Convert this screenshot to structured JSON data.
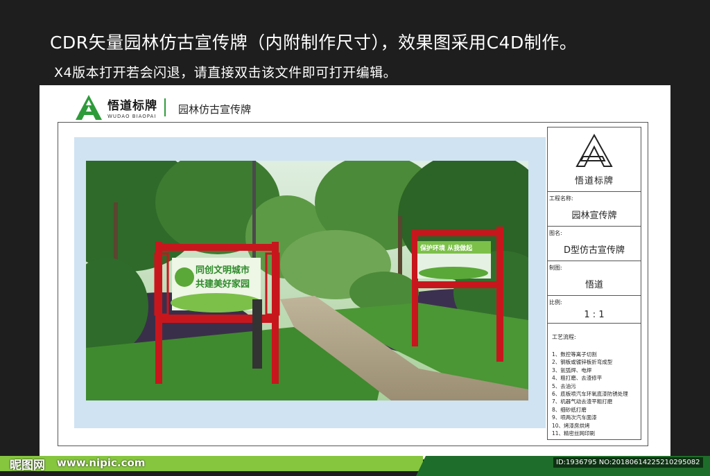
{
  "header": {
    "headline": "CDR矢量园林仿古宣传牌（内附制作尺寸），效果图采用C4D制作。",
    "subline": "X4版本打开若会闪退，请直接双击该文件即可打开编辑。"
  },
  "brand": {
    "name_cn": "悟道标牌",
    "name_en": "WUDAO BIAOPAI",
    "title": "园林仿古宣传牌",
    "accent": "#2e9b3a"
  },
  "signs": {
    "left_text_1": "同创文明城市",
    "left_text_2": "共建美好家园",
    "right_text": "保护环境 从我做起"
  },
  "info": {
    "logo_text": "悟道标牌",
    "project_label": "工程名称:",
    "project_value": "园林宣传牌",
    "drawing_label": "图名:",
    "drawing_value": "D型仿古宣传牌",
    "maker_label": "制图:",
    "maker_value": "悟道",
    "scale_label": "比例:",
    "scale_value": "1 : 1",
    "process_title": "工艺流程:",
    "process_steps": [
      "1、数控等离子切割",
      "2、钢板或镀锌板折弯成型",
      "3、氩弧焊、电焊",
      "4、粗打磨、去渣修平",
      "5、去油污",
      "6、底板喷汽车环氧底漆防锈处理",
      "7、机器气动去渣平粗打磨",
      "8、细砂纸打磨",
      "9、喷两次汽车面漆",
      "10、烤漆房烘烤",
      "11、精密丝网印刷"
    ]
  },
  "watermark": {
    "logo": "昵图网",
    "url": "www.nipic.com",
    "id": "ID:1936795 NO:20180614225210295082"
  },
  "colors": {
    "background": "#1e1e1e",
    "footer_green": "#86c63f",
    "footer_dark": "#1f6d2a",
    "sign_red": "#c8161d"
  }
}
